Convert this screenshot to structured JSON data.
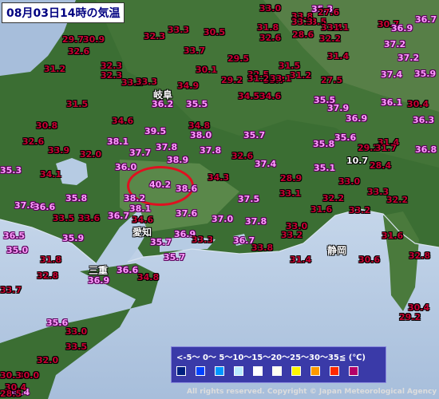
{
  "title": "08月03日14時の気温",
  "copyright": "All rights reserved. Copyright © Japan Meteorological Agency",
  "legend": {
    "scale_text": "<-5～ 0～ 5～10～15～20～25～30～35≦ (℃)",
    "swatches": [
      {
        "label": "<-5",
        "color": "#002080"
      },
      {
        "label": "-5～0",
        "color": "#0041ff"
      },
      {
        "label": "0～5",
        "color": "#0096ff"
      },
      {
        "label": "5～10",
        "color": "#b9ebff"
      },
      {
        "label": "10～15",
        "color": "#ffffff"
      },
      {
        "label": "15～20",
        "color": "#fffff0"
      },
      {
        "label": "20～25",
        "color": "#fff500"
      },
      {
        "label": "25～30",
        "color": "#ff9900"
      },
      {
        "label": "30～35",
        "color": "#ff2800"
      },
      {
        "label": "35≦",
        "color": "#b40068"
      }
    ]
  },
  "cities": [
    {
      "name": "岐阜"
    },
    {
      "name": "愛知"
    },
    {
      "name": "三重"
    },
    {
      "name": "静岡"
    }
  ],
  "temperatures": [
    {
      "v": "29.7"
    },
    {
      "v": "30.9"
    },
    {
      "v": "32.6"
    },
    {
      "v": "31.2"
    },
    {
      "v": "32.3"
    },
    {
      "v": "32.3"
    },
    {
      "v": "33.2"
    },
    {
      "v": "33.3"
    },
    {
      "v": "32.3"
    },
    {
      "v": "33.3"
    },
    {
      "v": "34.9"
    },
    {
      "v": "33.7"
    },
    {
      "v": "36.2"
    },
    {
      "v": "35.5"
    },
    {
      "v": "31.5"
    },
    {
      "v": "30.8"
    },
    {
      "v": "32.6"
    },
    {
      "v": "34.6"
    },
    {
      "v": "33.9"
    },
    {
      "v": "32.0"
    },
    {
      "v": "34.1"
    },
    {
      "v": "35.3"
    },
    {
      "v": "37.8"
    },
    {
      "v": "36.6"
    },
    {
      "v": "35.8"
    },
    {
      "v": "33.5"
    },
    {
      "v": "33.6"
    },
    {
      "v": "36.0"
    },
    {
      "v": "38.1"
    },
    {
      "v": "37.7"
    },
    {
      "v": "37.8"
    },
    {
      "v": "38.9"
    },
    {
      "v": "39.5"
    },
    {
      "v": "36.7"
    },
    {
      "v": "34.6"
    },
    {
      "v": "38.2"
    },
    {
      "v": "38.1"
    },
    {
      "v": "40.2"
    },
    {
      "v": "38.6"
    },
    {
      "v": "37.6"
    },
    {
      "v": "36.9"
    },
    {
      "v": "35.7"
    },
    {
      "v": "35.7"
    },
    {
      "v": "35.9"
    },
    {
      "v": "36.5"
    },
    {
      "v": "35.0"
    },
    {
      "v": "31.8"
    },
    {
      "v": "32.8"
    },
    {
      "v": "36.9"
    },
    {
      "v": "36.6"
    },
    {
      "v": "34.8"
    },
    {
      "v": "33.7"
    },
    {
      "v": "35.6"
    },
    {
      "v": "33.0"
    },
    {
      "v": "33.5"
    },
    {
      "v": "32.0"
    },
    {
      "v": "30.0"
    },
    {
      "v": "35.4"
    },
    {
      "v": "38.0"
    },
    {
      "v": "37.8"
    },
    {
      "v": "34.8"
    },
    {
      "v": "34.3"
    },
    {
      "v": "32.6"
    },
    {
      "v": "35.7"
    },
    {
      "v": "37.4"
    },
    {
      "v": "37.5"
    },
    {
      "v": "37.0"
    },
    {
      "v": "37.8"
    },
    {
      "v": "36.7"
    },
    {
      "v": "33.3"
    },
    {
      "v": "33.8"
    },
    {
      "v": "33.2"
    },
    {
      "v": "33.0"
    },
    {
      "v": "31.4"
    },
    {
      "v": "28.9"
    },
    {
      "v": "33.1"
    },
    {
      "v": "31.6"
    },
    {
      "v": "32.2"
    },
    {
      "v": "33.3"
    },
    {
      "v": "32.2"
    },
    {
      "v": "33.0"
    },
    {
      "v": "35.1"
    },
    {
      "v": "35.8"
    },
    {
      "v": "30.1"
    },
    {
      "v": "29.2"
    },
    {
      "v": "29.5"
    },
    {
      "v": "33.7"
    },
    {
      "v": "32.5"
    },
    {
      "v": "34.5"
    },
    {
      "v": "34.6"
    },
    {
      "v": "31.2"
    },
    {
      "v": "33.1"
    },
    {
      "v": "31.5"
    },
    {
      "v": "31.2"
    },
    {
      "v": "35.3"
    },
    {
      "v": "33.5"
    },
    {
      "v": "32.6"
    },
    {
      "v": "31.8"
    },
    {
      "v": "30.5"
    },
    {
      "v": "33.0"
    },
    {
      "v": "33.8"
    },
    {
      "v": "33.3"
    },
    {
      "v": "27.6"
    },
    {
      "v": "32.2"
    },
    {
      "v": "31.4"
    },
    {
      "v": "31.1"
    },
    {
      "v": "28.6"
    },
    {
      "v": "31.4"
    },
    {
      "v": "27.5"
    },
    {
      "v": "35.9"
    },
    {
      "v": "35.5"
    },
    {
      "v": "37.9"
    },
    {
      "v": "36.9"
    },
    {
      "v": "35.6"
    },
    {
      "v": "31.4"
    },
    {
      "v": "29.2"
    },
    {
      "v": "10.7"
    },
    {
      "v": "28.4"
    },
    {
      "v": "33.2"
    },
    {
      "v": "31.6"
    },
    {
      "v": "30.6"
    },
    {
      "v": "32.8"
    },
    {
      "v": "30.7"
    },
    {
      "v": "36.9"
    },
    {
      "v": "37.2"
    },
    {
      "v": "36.7"
    },
    {
      "v": "37.2"
    },
    {
      "v": "37.4"
    },
    {
      "v": "35.9"
    },
    {
      "v": "36.1"
    },
    {
      "v": "30.4"
    },
    {
      "v": "36.3"
    },
    {
      "v": "36.8"
    },
    {
      "v": "31.7"
    },
    {
      "v": "30.4"
    },
    {
      "v": "29.2"
    },
    {
      "v": "30.3"
    },
    {
      "v": "30.4"
    },
    {
      "v": "28.5"
    }
  ]
}
